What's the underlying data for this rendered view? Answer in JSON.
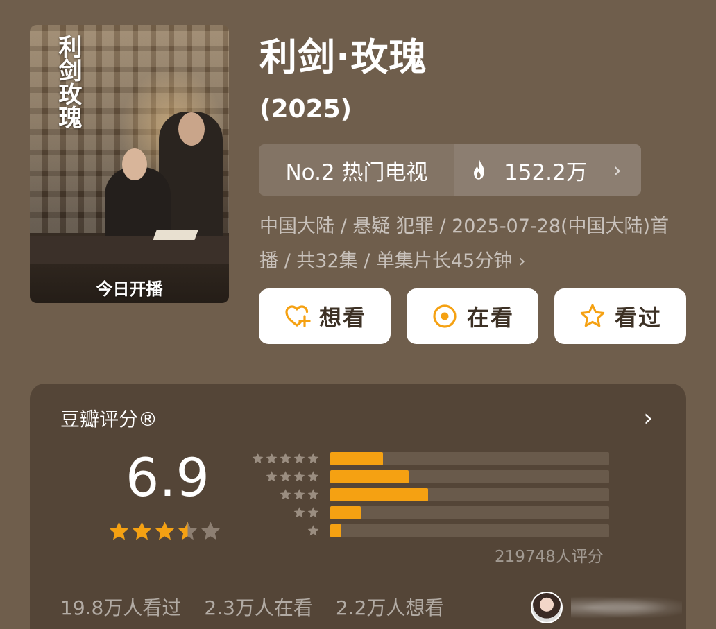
{
  "poster": {
    "vertical_title": "利剑玫瑰",
    "banner": "今日开播"
  },
  "title": "利剑·玫瑰",
  "year": "(2025)",
  "rank": {
    "label": "No.2 热门电视",
    "heat": "152.2万",
    "chevron": "›"
  },
  "meta": "中国大陆 / 悬疑 犯罪 / 2025-07-28(中国大陆)首播 / 共32集 / 单集片长45分钟 ›",
  "actions": {
    "want": "想看",
    "doing": "在看",
    "done": "看过"
  },
  "rating": {
    "title": "豆瓣评分®",
    "chevron": "›",
    "score": "6.9",
    "stars_value": 3.5,
    "stars_max": 5,
    "distribution": [
      {
        "stars": 5,
        "fraction": 0.19
      },
      {
        "stars": 4,
        "fraction": 0.28
      },
      {
        "stars": 3,
        "fraction": 0.35
      },
      {
        "stars": 2,
        "fraction": 0.11
      },
      {
        "stars": 1,
        "fraction": 0.04
      }
    ],
    "votes": "219748人评分"
  },
  "stats": {
    "watched": "19.8万人看过",
    "watching": "2.3万人在看",
    "want": "2.2万人想看"
  },
  "colors": {
    "accent": "#f5a112",
    "background": "#6f5e4c",
    "card": "#544537"
  }
}
